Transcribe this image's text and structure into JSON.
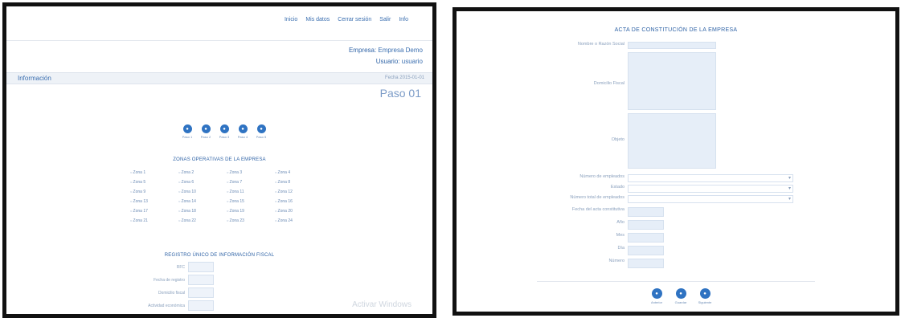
{
  "left": {
    "nav": [
      "Inicio",
      "Mis datos",
      "Cerrar sesión",
      "Salir",
      "Info"
    ],
    "empresa_label": "Empresa:",
    "empresa_value": "Empresa Demo",
    "usuario_label": "Usuario:",
    "usuario_value": "usuario",
    "bar_title": "Información",
    "bar_right": "Fecha 2015-01-01",
    "paso": "Paso 01",
    "steps": [
      "Paso 1",
      "Paso 2",
      "Paso 3",
      "Paso 4",
      "Paso 5"
    ],
    "zonas_title": "ZONAS OPERATIVAS DE LA EMPRESA",
    "zonas": [
      "Zona 1",
      "Zona 2",
      "Zona 3",
      "Zona 4",
      "Zona 5",
      "Zona 6",
      "Zona 7",
      "Zona 8",
      "Zona 9",
      "Zona 10",
      "Zona 11",
      "Zona 12",
      "Zona 13",
      "Zona 14",
      "Zona 15",
      "Zona 16",
      "Zona 17",
      "Zona 18",
      "Zona 19",
      "Zona 20",
      "Zona 21",
      "Zona 22",
      "Zona 23",
      "Zona 24"
    ],
    "registro_title": "REGISTRO ÚNICO DE INFORMACIÓN FISCAL",
    "fields": [
      "RFC",
      "Fecha de registro",
      "Domicilio fiscal",
      "Actividad económica"
    ],
    "watermark": "Activar Windows"
  },
  "right": {
    "title": "ACTA DE CONSTITUCIÓN DE LA EMPRESA",
    "nombre_label": "Nombre o Razón Social",
    "domicilio_label": "Domicilio Fiscal",
    "objeto_label": "Objeto",
    "select_labels": [
      "Número de empleados",
      "Estado",
      "Número total de empleados"
    ],
    "fecha_label": "Fecha del acta constitutiva",
    "small_fields": [
      "Año",
      "Mes",
      "Día",
      "Número"
    ],
    "buttons": [
      "Anterior",
      "Guardar",
      "Siguiente"
    ]
  }
}
